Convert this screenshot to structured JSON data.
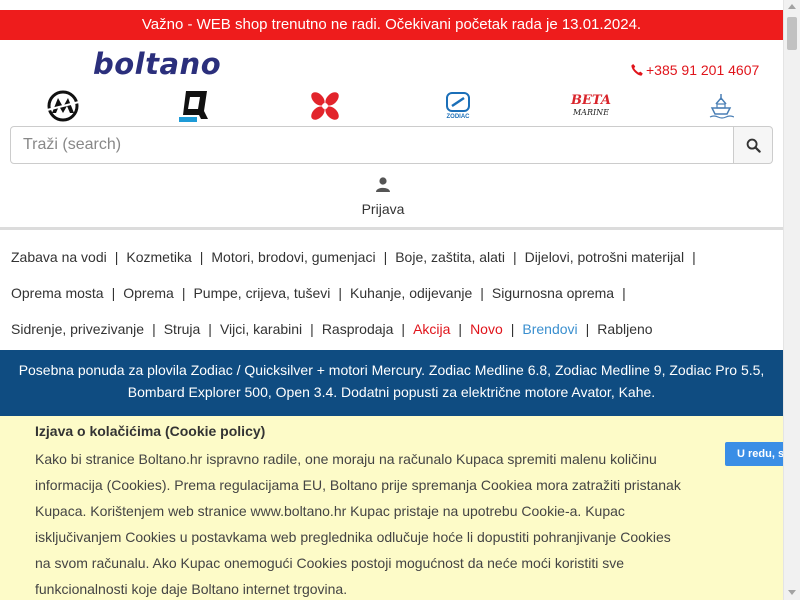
{
  "notice": {
    "text": "Važno - WEB shop trenutno ne radi. Očekivani početak rada je 13.01.2024.",
    "color": "#ee1c1c"
  },
  "header": {
    "logo_text": "boltano",
    "phone": "+385 91 201 4607",
    "phone_icon": "phone-icon"
  },
  "brands": [
    {
      "name": "mercury-logo-icon"
    },
    {
      "name": "quicksilver-logo-icon"
    },
    {
      "name": "propeller-icon"
    },
    {
      "name": "zodiac-logo-icon",
      "label": "ZODIAC"
    },
    {
      "name": "beta-marine-logo-icon",
      "label_top": "BETA",
      "label_bottom": "MARINE"
    },
    {
      "name": "boat-icon"
    }
  ],
  "search": {
    "placeholder": "Traži (search)",
    "value": "",
    "icon": "search-icon"
  },
  "account": {
    "login_label": "Prijava",
    "icon": "user-icon"
  },
  "nav": {
    "rows": [
      [
        {
          "label": "Zabava na vodi",
          "style": "normal"
        },
        {
          "label": "Kozmetika",
          "style": "normal"
        },
        {
          "label": "Motori, brodovi, gumenjaci",
          "style": "normal"
        },
        {
          "label": "Boje, zaštita, alati",
          "style": "normal"
        },
        {
          "label": "Dijelovi, potrošni materijal",
          "style": "normal"
        }
      ],
      [
        {
          "label": "Oprema mosta",
          "style": "normal"
        },
        {
          "label": "Oprema",
          "style": "normal"
        },
        {
          "label": "Pumpe, crijeva, tuševi",
          "style": "normal"
        },
        {
          "label": "Kuhanje, odijevanje",
          "style": "normal"
        },
        {
          "label": "Sigurnosna oprema",
          "style": "normal"
        }
      ],
      [
        {
          "label": "Sidrenje, privezivanje",
          "style": "normal"
        },
        {
          "label": "Struja",
          "style": "normal"
        },
        {
          "label": "Vijci, karabini",
          "style": "normal"
        },
        {
          "label": "Rasprodaja",
          "style": "normal"
        },
        {
          "label": "Akcija",
          "style": "red"
        },
        {
          "label": "Novo",
          "style": "red"
        },
        {
          "label": "Brendovi",
          "style": "blue"
        },
        {
          "label": "Rabljeno",
          "style": "normal"
        }
      ]
    ],
    "trailing_separator_rows": [
      0,
      1
    ],
    "colors": {
      "red": "#e0141b",
      "blue": "#3a8fcf"
    }
  },
  "promo": {
    "line1": "Posebna ponuda za plovila Zodiac / Quicksilver + motori Mercury. Zodiac Medline 6.8, Zodiac Medline 9, Zodiac Pro 5.5,",
    "line2": "Bombard Explorer 500, Open 3.4. Dodatni popusti za električne motore Avator, Kahe.",
    "color": "#0f4c81"
  },
  "cookie": {
    "title": "Izjava o kolačićima (Cookie policy)",
    "lines": [
      "Kako bi stranice Boltano.hr ispravno radile, one moraju na računalo Kupaca spremiti malenu količinu",
      "informacija (Cookies). Prema regulacijama EU, Boltano prije spremanja Cookiea mora zatražiti pristanak",
      "Kupaca. Korištenjem web stranice www.boltano.hr Kupac pristaje na upotrebu Cookie-a. Kupac",
      "isključivanjem Cookies u postavkama web preglednika odlučuje hoće li dopustiti pohranjivanje Cookies",
      "na svom računalu. Ako Kupac onemogući Cookies postoji mogućnost da neće moći koristiti sve",
      "funkcionalnosti koje daje Boltano internet trgovina."
    ],
    "accept_label": "U redu, s",
    "background": "#fdfbc8"
  }
}
